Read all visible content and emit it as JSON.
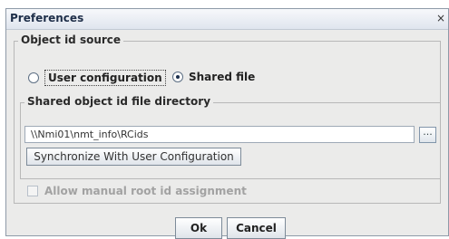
{
  "window": {
    "title": "Preferences",
    "close_icon": "close-icon",
    "close_glyph": "×"
  },
  "object_id_source": {
    "legend": "Object id source",
    "options": [
      {
        "label": "User configuration",
        "selected": false,
        "focused": true
      },
      {
        "label": "Shared file",
        "selected": true,
        "focused": false
      }
    ]
  },
  "shared_directory": {
    "legend": "Shared object id file directory",
    "path_value": "\\\\Nmi01\\nmt_info\\RCids",
    "browse_label": "...",
    "sync_button_label": "Synchronize With User Configuration"
  },
  "manual_root": {
    "label": "Allow manual root id assignment",
    "checked": false,
    "enabled": false
  },
  "buttons": {
    "ok_label": "Ok",
    "cancel_label": "Cancel"
  }
}
